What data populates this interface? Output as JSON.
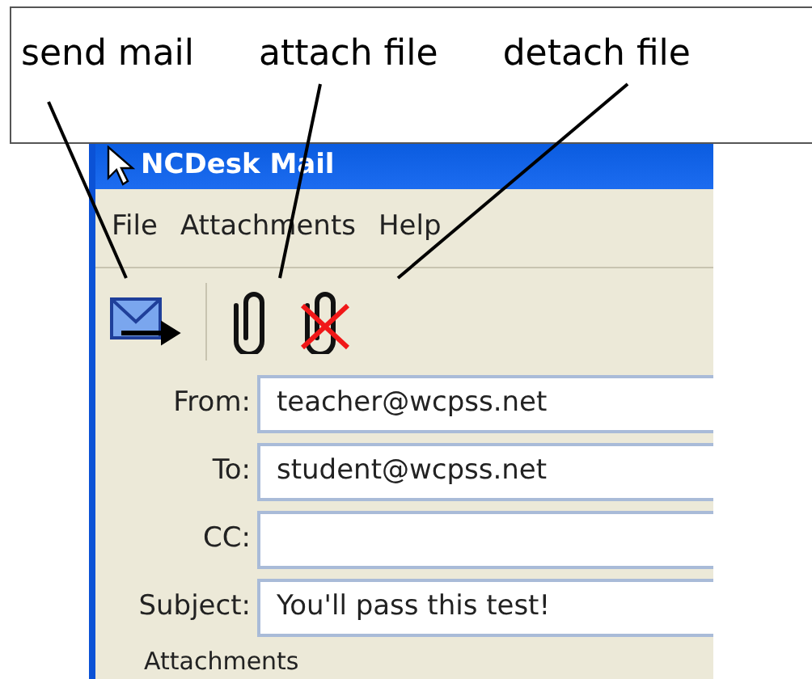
{
  "annotations": [
    {
      "label": "send mail"
    },
    {
      "label": "attach file"
    },
    {
      "label": "detach file"
    }
  ],
  "window": {
    "title": "NCDesk Mail"
  },
  "menu": [
    "File",
    "Attachments",
    "Help"
  ],
  "toolbar": [
    {
      "kind": "send"
    },
    {
      "kind": "attach"
    },
    {
      "kind": "detach"
    }
  ],
  "fields": [
    {
      "label": "From:",
      "value": "teacher@wcpss.net"
    },
    {
      "label": "To:",
      "value": "student@wcpss.net"
    },
    {
      "label": "CC:"
    },
    {
      "label": "Subject:",
      "value": "You'll pass this test!"
    }
  ],
  "attachments_label": "Attachments"
}
